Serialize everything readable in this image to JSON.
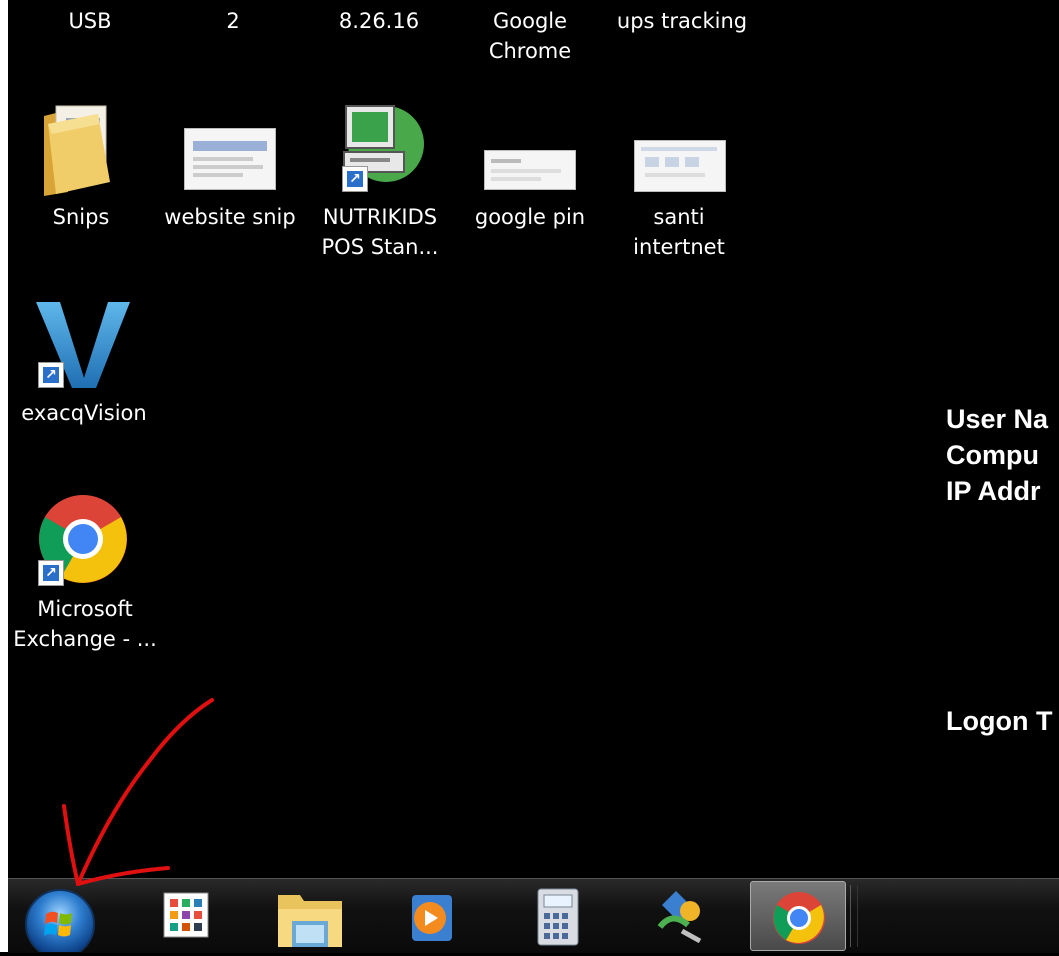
{
  "desktop": {
    "top_row": [
      "USB",
      "2",
      "8.26.16",
      "Google\nChrome",
      "ups tracking"
    ],
    "icons": [
      {
        "label_line1": "Snips",
        "label_line2": "",
        "icon": "folder-icon"
      },
      {
        "label_line1": "website snip",
        "label_line2": "",
        "icon": "image-thumbnail-icon"
      },
      {
        "label_line1": "NUTRIKIDS",
        "label_line2": "POS Stan...",
        "icon": "pos-terminal-icon"
      },
      {
        "label_line1": "google pin",
        "label_line2": "",
        "icon": "image-thumbnail-icon"
      },
      {
        "label_line1": "santi",
        "label_line2": "intertnet",
        "icon": "image-thumbnail-icon"
      },
      {
        "label_line1": "exacqVision",
        "label_line2": "",
        "icon": "exacqvision-icon"
      },
      {
        "label_line1": "Microsoft",
        "label_line2": "Exchange - ...",
        "icon": "chrome-icon"
      }
    ]
  },
  "top_labels": {
    "usb": "USB",
    "two": "2",
    "date": "8.26.16",
    "chrome_line1": "Google",
    "chrome_line2": "Chrome",
    "ups": "ups tracking"
  },
  "bginfo": {
    "line1": "User Na",
    "line2": "Compu",
    "line3": "IP Addr",
    "line4": "Logon T"
  },
  "taskbar": {
    "items": [
      "start-button",
      "metro-apps-icon",
      "file-explorer-icon",
      "media-player-icon",
      "calculator-icon",
      "network-tool-icon",
      "chrome-icon"
    ]
  },
  "annotation": {
    "color": "#e01010"
  }
}
